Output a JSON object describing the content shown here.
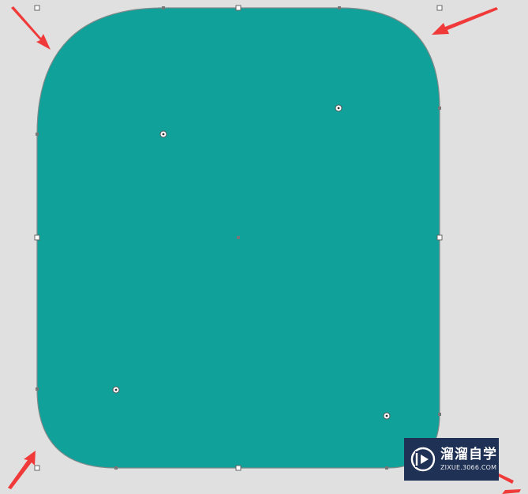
{
  "shape": {
    "fill_color": "#10a19a",
    "stroke_color": "#7d8a89"
  },
  "arrow_color": "#f03a3a",
  "watermark": {
    "title": "溜溜自学",
    "url": "ZIXUE.3066.COM",
    "background": "#1f3154"
  }
}
